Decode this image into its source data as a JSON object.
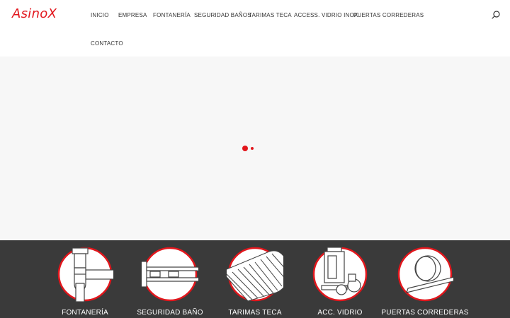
{
  "brand": {
    "logo_text": "AsinoX",
    "accent_color": "#e2161c"
  },
  "nav": {
    "items": [
      {
        "label": "INICIO"
      },
      {
        "label": "EMPRESA"
      },
      {
        "label": "FONTANERÍA"
      },
      {
        "label": "SEGURIDAD BAÑOS"
      },
      {
        "label": "TARIMAS TECA"
      },
      {
        "label": "ACCESS. VIDRIO INOX"
      },
      {
        "label": "PUERTAS CORREDERAS"
      },
      {
        "label": "CONTACTO"
      }
    ],
    "search_icon": "search-icon"
  },
  "slider": {
    "loading_indicator": "dots",
    "background": "#f7f7f7"
  },
  "categories": {
    "background": "#3a3a3a",
    "items": [
      {
        "label": "FONTANERÍA",
        "icon": "siphon-icon"
      },
      {
        "label": "SEGURIDAD BAÑO",
        "icon": "grab-bar-icon"
      },
      {
        "label": "TARIMAS TECA",
        "icon": "teak-mat-icon"
      },
      {
        "label": "ACC. VIDRIO",
        "icon": "glass-fittings-icon"
      },
      {
        "label": "PUERTAS CORREDERAS",
        "icon": "sliding-door-wheel-icon"
      }
    ]
  }
}
